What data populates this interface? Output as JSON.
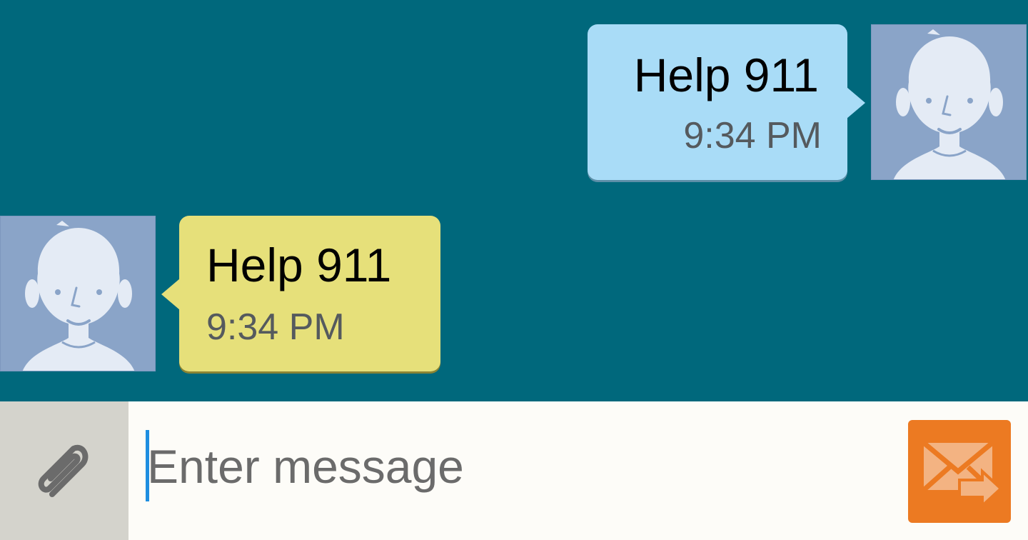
{
  "conversation": {
    "messages": [
      {
        "direction": "outgoing",
        "text": "Help 911",
        "time": "9:34 PM",
        "bubble_color": "#a9dcf7"
      },
      {
        "direction": "incoming",
        "text": "Help 911",
        "time": "9:34 PM",
        "bubble_color": "#e6e07a"
      }
    ],
    "background_color": "#00687c"
  },
  "avatar": {
    "icon": "person-silhouette-icon",
    "background_color": "#8aa4c8"
  },
  "composer": {
    "input_placeholder": "Enter message",
    "input_value": "",
    "attach_icon": "paperclip-icon",
    "send_icon": "send-envelope-icon",
    "send_color": "#ec7a22"
  }
}
